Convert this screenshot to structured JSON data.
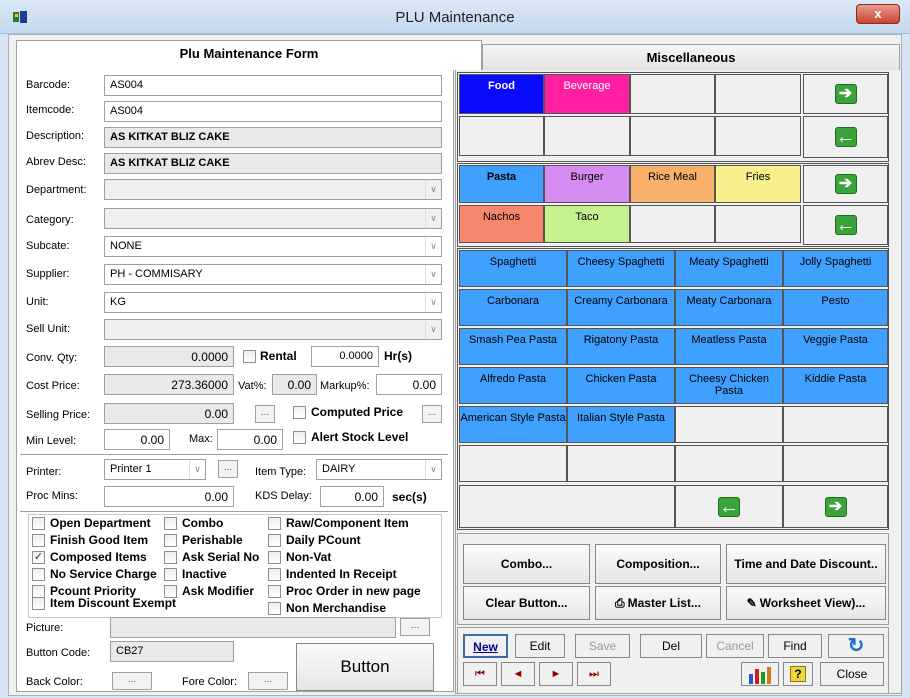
{
  "window": {
    "title": "PLU Maintenance",
    "close_glyph": "x"
  },
  "tabs": {
    "form": "Plu Maintenance Form",
    "misc": "Miscellaneous"
  },
  "fields": {
    "barcode": {
      "label": "Barcode:",
      "value": "AS004"
    },
    "itemcode": {
      "label": "Itemcode:",
      "value": "AS004"
    },
    "description": {
      "label": "Description:",
      "value": "AS KITKAT BLIZ CAKE"
    },
    "abrev": {
      "label": "Abrev Desc:",
      "value": "AS KITKAT BLIZ CAKE"
    },
    "department": {
      "label": "Department:",
      "value": ""
    },
    "category": {
      "label": "Category:",
      "value": ""
    },
    "subcate": {
      "label": "Subcate:",
      "value": "NONE"
    },
    "supplier": {
      "label": "Supplier:",
      "value": "PH - COMMISARY"
    },
    "unit": {
      "label": "Unit:",
      "value": "KG"
    },
    "sell_unit": {
      "label": "Sell Unit:",
      "value": ""
    },
    "conv_qty": {
      "label": "Conv. Qty:",
      "value": "0.0000"
    },
    "rental": {
      "label": "Rental",
      "value": "0.0000",
      "unit": "Hr(s)"
    },
    "cost_price": {
      "label": "Cost Price:",
      "value": "273.36000"
    },
    "vat": {
      "label": "Vat%:",
      "value": "0.00"
    },
    "markup": {
      "label": "Markup%:",
      "value": "0.00"
    },
    "selling_price": {
      "label": "Selling Price:",
      "value": "0.00"
    },
    "computed_price": {
      "label": "Computed Price"
    },
    "min_level": {
      "label": "Min Level:",
      "value": "0.00"
    },
    "max": {
      "label": "Max:",
      "value": "0.00"
    },
    "alert_stock": {
      "label": "Alert Stock Level"
    },
    "printer": {
      "label": "Printer:",
      "value": "Printer 1"
    },
    "item_type": {
      "label": "Item Type:",
      "value": "DAIRY"
    },
    "proc_mins": {
      "label": "Proc Mins:",
      "value": "0.00"
    },
    "kds_delay": {
      "label": "KDS Delay:",
      "value": "0.00",
      "unit": "sec(s)"
    },
    "picture": {
      "label": "Picture:",
      "value": ""
    },
    "button_code": {
      "label": "Button Code:",
      "value": "CB27"
    },
    "back_color": {
      "label": "Back Color:"
    },
    "fore_color": {
      "label": "Fore Color:"
    },
    "ellipsis": "...",
    "button_preview": "Button"
  },
  "checkboxes": {
    "col1": [
      {
        "label": "Open Department",
        "checked": false
      },
      {
        "label": "Finish Good Item",
        "checked": false
      },
      {
        "label": "Composed Items",
        "checked": true
      },
      {
        "label": "No Service Charge",
        "checked": false
      },
      {
        "label": "Pcount Priority",
        "checked": false
      },
      {
        "label": "Item Discount Exempt",
        "checked": false
      }
    ],
    "col2": [
      {
        "label": "Combo",
        "checked": false
      },
      {
        "label": "Perishable",
        "checked": false
      },
      {
        "label": "Ask Serial No",
        "checked": false
      },
      {
        "label": "Inactive",
        "checked": false
      },
      {
        "label": "Ask Modifier",
        "checked": false
      }
    ],
    "col3": [
      {
        "label": "Raw/Component Item",
        "checked": false
      },
      {
        "label": "Daily PCount",
        "checked": false
      },
      {
        "label": "Non-Vat",
        "checked": false
      },
      {
        "label": "Indented In Receipt",
        "checked": false
      },
      {
        "label": "Proc Order in new page",
        "checked": false
      },
      {
        "label": "Non Merchandise",
        "checked": false
      }
    ]
  },
  "departments": [
    {
      "label": "Food",
      "color": "#0a0aff",
      "text_color": "#ffffff"
    },
    {
      "label": "Beverage",
      "color": "#ff1fa0",
      "text_color": "#ffffff"
    }
  ],
  "categories": [
    {
      "label": "Pasta",
      "color": "#3fa0ff"
    },
    {
      "label": "Burger",
      "color": "#d48cf0"
    },
    {
      "label": "Rice Meal",
      "color": "#f7b06a"
    },
    {
      "label": "Fries",
      "color": "#f7f08c"
    },
    {
      "label": "Nachos",
      "color": "#f7866f"
    },
    {
      "label": "Taco",
      "color": "#c5f28f"
    }
  ],
  "items": [
    "Spaghetti",
    "Cheesy Spaghetti",
    "Meaty Spaghetti",
    "Jolly Spaghetti",
    "Carbonara",
    "Creamy Carbonara",
    "Meaty Carbonara",
    "Pesto",
    "Smash Pea Pasta",
    "Rigatony Pasta",
    "Meatless Pasta",
    "Veggie Pasta",
    "Alfredo Pasta",
    "Chicken Pasta",
    "Cheesy Chicken Pasta",
    "Kiddie Pasta",
    "American Style Pasta",
    "Italian Style Pasta"
  ],
  "item_color": "#3fa0ff",
  "actions": {
    "combo": "Combo...",
    "composition": "Composition...",
    "time_date": "Time and Date Discount..",
    "clear": "Clear Button...",
    "master_list": "Master List...",
    "worksheet": "Worksheet View)..."
  },
  "toolbar": {
    "new": "New",
    "edit": "Edit",
    "save": "Save",
    "del": "Del",
    "cancel": "Cancel",
    "find": "Find",
    "close": "Close"
  }
}
